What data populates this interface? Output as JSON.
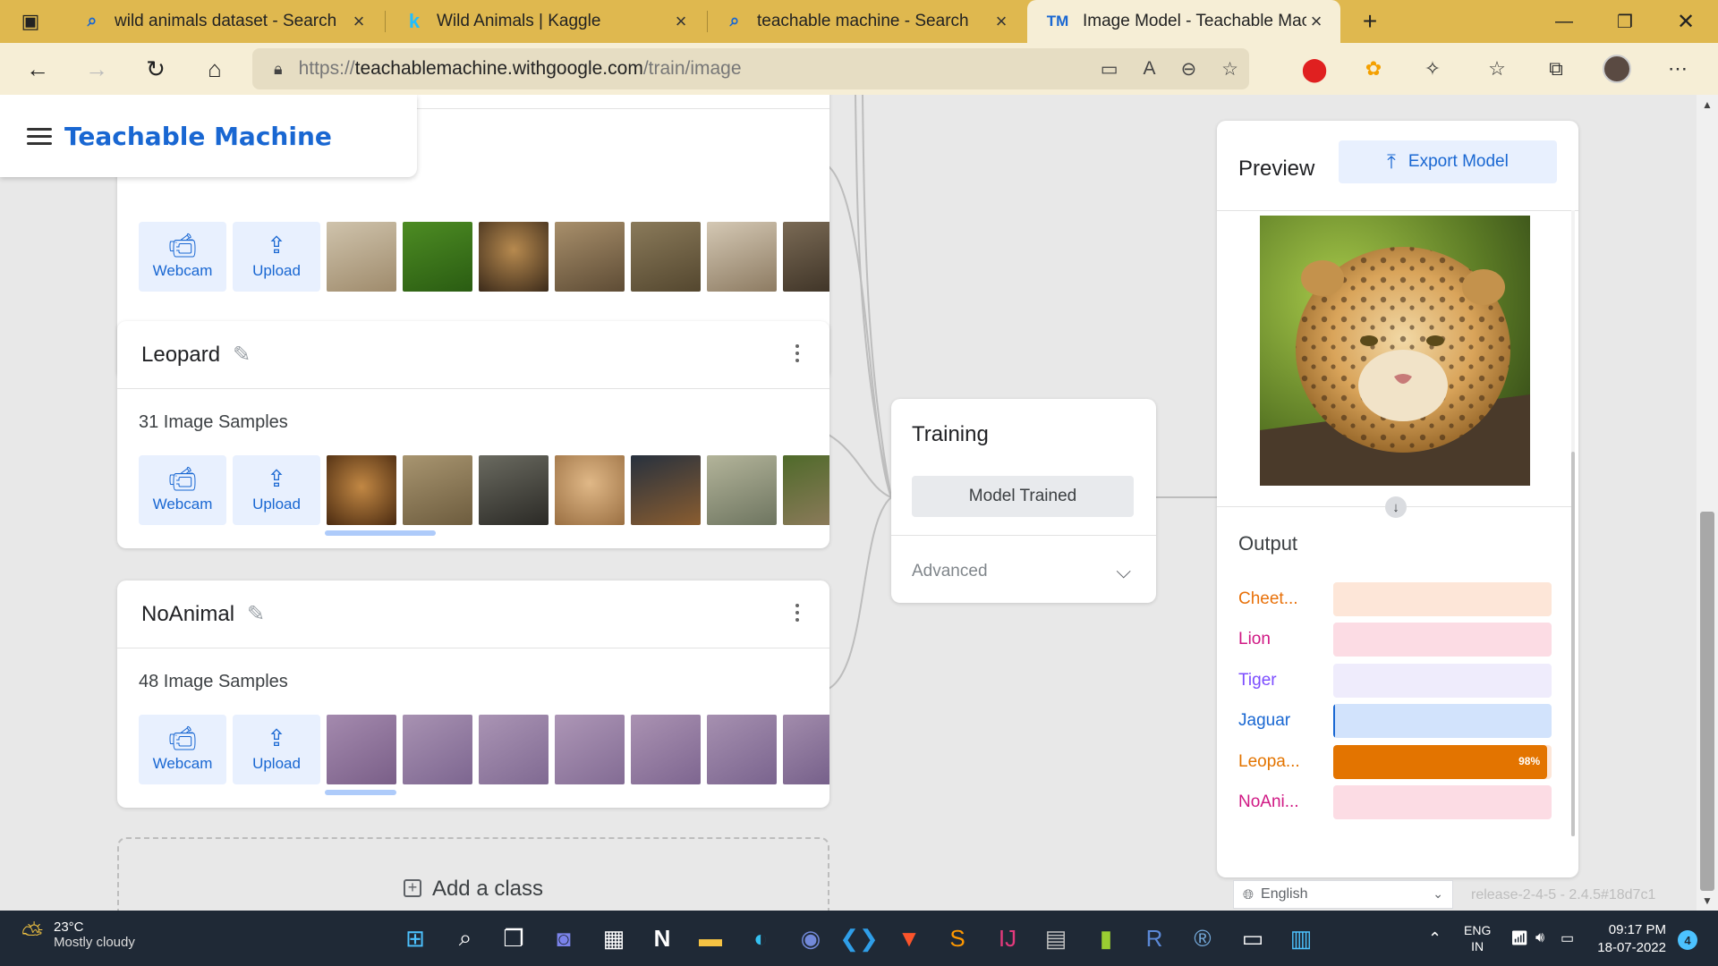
{
  "browser": {
    "tabs": [
      {
        "title": "wild animals dataset - Search",
        "icon": "search-icon",
        "active": false
      },
      {
        "title": "Wild Animals | Kaggle",
        "icon": "kaggle-icon",
        "active": false
      },
      {
        "title": "teachable machine - Search",
        "icon": "search-icon",
        "active": false
      },
      {
        "title": "Image Model - Teachable Machin",
        "icon": "teachable-machine-icon",
        "active": true
      }
    ],
    "url_prefix": "https://",
    "url_host": "teachablemachine.withgoogle.com",
    "url_path": "/train/image"
  },
  "app": {
    "brand": "Teachable Machine"
  },
  "classes": [
    {
      "name": "",
      "samples_label": "",
      "webcam_label": "Webcam",
      "upload_label": "Upload",
      "thumb_colors": [
        "#b7a58a",
        "#3d7a1e",
        "#6f4e2a",
        "#8d7558",
        "#7b6747",
        "#c2b4a0",
        "#6a5a45"
      ]
    },
    {
      "name": "Leopard",
      "samples_label": "31 Image Samples",
      "webcam_label": "Webcam",
      "upload_label": "Upload",
      "thumb_colors": [
        "#9a6a2c",
        "#8d7a57",
        "#3b3a34",
        "#c99f6e",
        "#4e3a2a",
        "#8f8f74",
        "#5a6040"
      ]
    },
    {
      "name": "NoAnimal",
      "samples_label": "48 Image Samples",
      "webcam_label": "Webcam",
      "upload_label": "Upload",
      "thumb_colors": [
        "#8a6f96",
        "#8f7a9a",
        "#917c9c",
        "#957e9e",
        "#917a9a",
        "#8d7698",
        "#8a7394"
      ]
    }
  ],
  "add_class_label": "Add a class",
  "training": {
    "title": "Training",
    "button_label": "Model Trained",
    "advanced_label": "Advanced"
  },
  "preview": {
    "title": "Preview",
    "export_label": "Export Model",
    "output_title": "Output",
    "outputs": [
      {
        "label": "Cheet...",
        "color": "#e8710a",
        "track": "#fde6d8",
        "value": 0,
        "pct_label": ""
      },
      {
        "label": "Lion",
        "color": "#d01884",
        "track": "#fcdce4",
        "value": 0,
        "pct_label": ""
      },
      {
        "label": "Tiger",
        "color": "#7c4dff",
        "track": "#efecfc",
        "value": 0,
        "pct_label": ""
      },
      {
        "label": "Jaguar",
        "color": "#1967d2",
        "track": "#d2e3fc",
        "value": 0.01,
        "pct_label": ""
      },
      {
        "label": "Leopa...",
        "color": "#e37400",
        "track": "#fde6d8",
        "value": 0.98,
        "pct_label": "98%"
      },
      {
        "label": "NoAni...",
        "color": "#d01884",
        "track": "#fcdce4",
        "value": 0,
        "pct_label": ""
      }
    ]
  },
  "footer": {
    "language": "English",
    "release": "release-2-4-5 - 2.4.5#18d7c1"
  },
  "taskbar": {
    "temperature": "23°C",
    "weather": "Mostly cloudy",
    "lang_line1": "ENG",
    "lang_line2": "IN",
    "time": "09:17 PM",
    "date": "18-07-2022",
    "notifications": "4"
  }
}
